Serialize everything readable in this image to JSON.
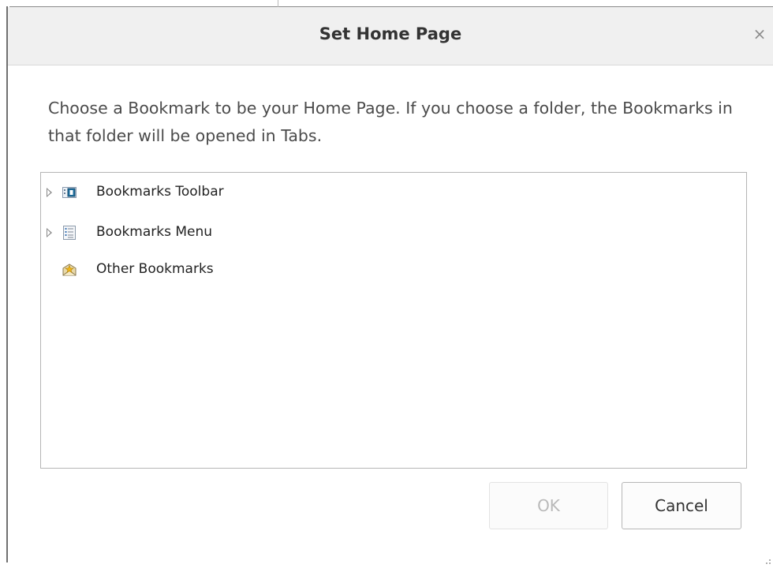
{
  "dialog": {
    "title": "Set Home Page",
    "close_label": "×",
    "description": "Choose a Bookmark to be your Home Page. If you choose a folder, the Bookmarks in that folder will be opened in Tabs."
  },
  "tree": {
    "items": [
      {
        "label": "Bookmarks Toolbar",
        "icon": "bookmarks-toolbar-icon",
        "expandable": true
      },
      {
        "label": "Bookmarks Menu",
        "icon": "bookmarks-menu-icon",
        "expandable": true
      },
      {
        "label": "Other Bookmarks",
        "icon": "other-bookmarks-icon",
        "expandable": false
      }
    ]
  },
  "buttons": {
    "ok_label": "OK",
    "cancel_label": "Cancel"
  }
}
